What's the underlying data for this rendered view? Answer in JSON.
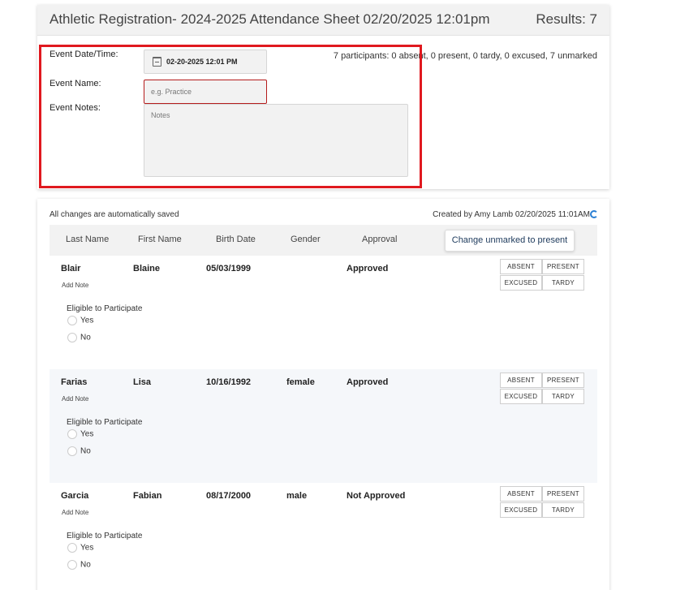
{
  "header": {
    "title": "Athletic Registration- 2024-2025 Attendance Sheet 02/20/2025 12:01pm",
    "results": "Results: 7"
  },
  "event_form": {
    "date_label": "Event Date/Time:",
    "date_value": "02-20-2025 12:01 PM",
    "name_label": "Event Name:",
    "name_placeholder": "e.g. Practice",
    "notes_label": "Event Notes:",
    "notes_placeholder": "Notes",
    "summary": "7 participants: 0 absent, 0 present, 0 tardy, 0 excused, 7 unmarked"
  },
  "status": {
    "saved": "All changes are automatically saved",
    "created": "Created by Amy Lamb 02/20/2025 11:01AM"
  },
  "table": {
    "headers": [
      "Last Name",
      "First Name",
      "Birth Date",
      "Gender",
      "Approval"
    ],
    "change_button": "Change unmarked to present",
    "add_note": "Add Note",
    "eligible_label": "Eligible to Participate",
    "yes": "Yes",
    "no": "No",
    "attendance": [
      "ABSENT",
      "PRESENT",
      "EXCUSED",
      "TARDY"
    ],
    "rows": [
      {
        "last": "Blair",
        "first": "Blaine",
        "birth": "05/03/1999",
        "gender": "",
        "approval": "Approved"
      },
      {
        "last": "Farias",
        "first": "Lisa",
        "birth": "10/16/1992",
        "gender": "female",
        "approval": "Approved"
      },
      {
        "last": "Garcia",
        "first": "Fabian",
        "birth": "08/17/2000",
        "gender": "male",
        "approval": "Not Approved"
      }
    ]
  },
  "colors": {
    "highlight": "#e0191f",
    "refresh_icon": "#2a7fd4"
  }
}
